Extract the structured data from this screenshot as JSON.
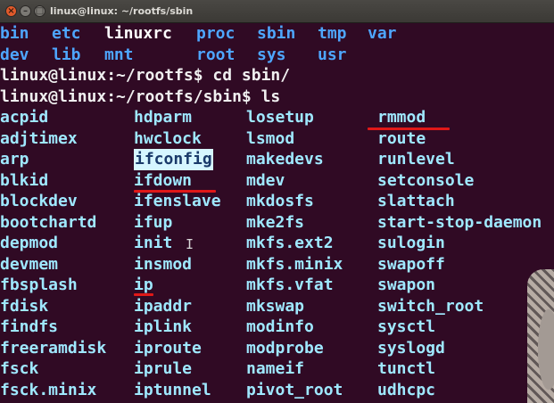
{
  "window": {
    "title": "linux@linux: ~/rootfs/sbin",
    "close_glyph": "×",
    "min_glyph": "–",
    "max_glyph": "□"
  },
  "terminal": {
    "ls_root_row1": [
      "bin",
      "etc",
      "linuxrc",
      "proc",
      "sbin",
      "tmp",
      "var"
    ],
    "ls_root_row2": [
      "dev",
      "lib",
      "mnt",
      "root",
      "sys",
      "usr"
    ],
    "prompt1": "linux@linux:~/rootfs$ cd sbin/",
    "prompt2": "linux@linux:~/rootfs/sbin$ ls",
    "col1": [
      "acpid",
      "adjtimex",
      "arp",
      "blkid",
      "blockdev",
      "bootchartd",
      "depmod",
      "devmem",
      "fbsplash",
      "fdisk",
      "findfs",
      "freeramdisk",
      "fsck",
      "fsck.minix"
    ],
    "col2": [
      "hdparm",
      "hwclock",
      "ifconfig",
      "ifdown",
      "ifenslave",
      "ifup",
      "init",
      "insmod",
      "ip",
      "ipaddr",
      "iplink",
      "iproute",
      "iprule",
      "iptunnel"
    ],
    "col3": [
      "losetup",
      "lsmod",
      "makedevs",
      "mdev",
      "mkdosfs",
      "mke2fs",
      "mkfs.ext2",
      "mkfs.minix",
      "mkfs.vfat",
      "mkswap",
      "modinfo",
      "modprobe",
      "nameif",
      "pivot_root"
    ],
    "col4": [
      "rmmod",
      "route",
      "runlevel",
      "setconsole",
      "slattach",
      "start-stop-daemon",
      "sulogin",
      "swapoff",
      "swapon",
      "switch_root",
      "sysctl",
      "syslogd",
      "tunctl",
      "udhcpc"
    ],
    "highlighted": "ifconfig",
    "colors": {
      "background": "#300a24",
      "directory": "#4ea6ff",
      "executable": "#9fe8ff",
      "annotation": "#e01818"
    }
  }
}
